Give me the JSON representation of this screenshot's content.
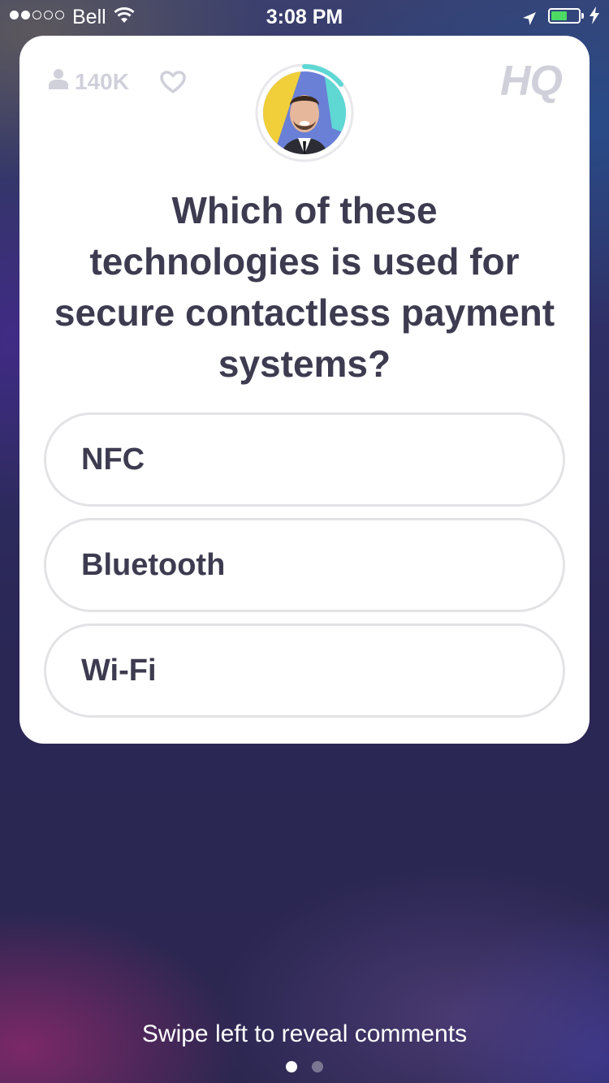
{
  "status_bar": {
    "carrier": "Bell",
    "time": "3:08 PM",
    "signal_bars_filled": 2,
    "signal_bars_total": 5,
    "battery_level": 0.6,
    "battery_color": "#4cd964"
  },
  "card": {
    "viewer_count": "140K",
    "logo": "HQ",
    "host_timer_accent": "#5fd8d4",
    "question": "Which of these technologies is used for secure contactless payment systems?",
    "answers": [
      {
        "label": "NFC"
      },
      {
        "label": "Bluetooth"
      },
      {
        "label": "Wi-Fi"
      }
    ]
  },
  "footer": {
    "hint": "Swipe left to reveal comments",
    "page_count": 2,
    "active_page": 1
  },
  "icons": {
    "viewers": "person-icon",
    "like": "heart-icon",
    "wifi": "wifi-icon",
    "location": "location-arrow-icon",
    "charging": "bolt-icon"
  }
}
